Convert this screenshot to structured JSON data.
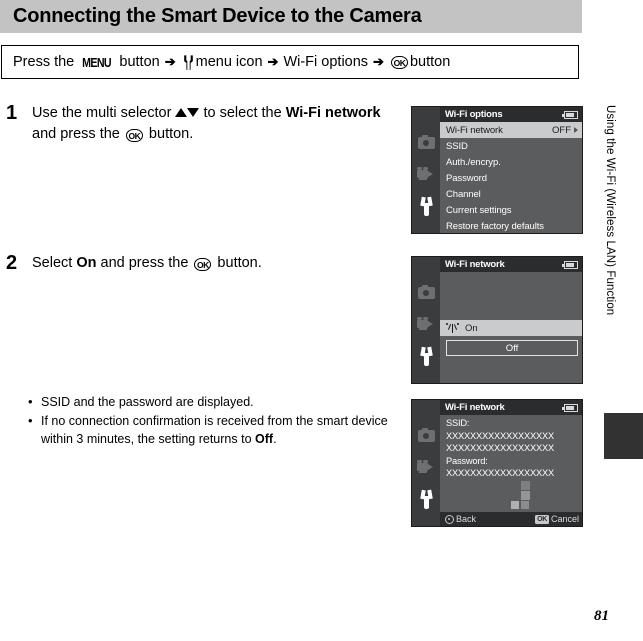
{
  "page": {
    "title": "Connecting the Smart Device to the Camera",
    "number": "81",
    "sidebar_label": "Using the Wi-Fi (Wireless LAN) Function"
  },
  "menu_path": {
    "prefix": "Press the",
    "menu_button": "MENU",
    "after_menu": "button",
    "arrow": "➔",
    "setup_icon": "wrench-icon",
    "setup_label": "menu icon",
    "option": "Wi-Fi options",
    "ok_label": "OK",
    "suffix": "button"
  },
  "steps": [
    {
      "number": "1",
      "text_part1": "Use the multi selector ",
      "up_arrow": "▲",
      "down_arrow": "▼",
      "text_part2": " to select the ",
      "bold1": "Wi-Fi network",
      "text_part3": " and press the ",
      "ok_label": "OK",
      "text_part4": " button."
    },
    {
      "number": "2",
      "text_part1": "Select ",
      "bold1": "On",
      "text_part2": " and press the ",
      "ok_label": "OK",
      "text_part3": " button."
    }
  ],
  "notes": [
    {
      "bullet": "•",
      "text": "SSID and the password are displayed."
    },
    {
      "bullet": "•",
      "text_part1": "If no connection confirmation is received from the smart device within 3 minutes, the setting returns to ",
      "bold": "Off",
      "text_part2": "."
    }
  ],
  "screens": [
    {
      "id": "wifi-options-menu",
      "header_title": "Wi-Fi options",
      "battery_icon": "battery-icon",
      "tabs": [
        "camera-icon",
        "movie-icon",
        "wrench-icon"
      ],
      "active_tab": "wrench-icon",
      "rows": [
        {
          "label": "Wi-Fi network",
          "value": "OFF",
          "selected": true,
          "has_caret": true
        },
        {
          "label": "SSID",
          "value": "",
          "selected": false,
          "has_caret": false
        },
        {
          "label": "Auth./encryp.",
          "value": "",
          "selected": false,
          "has_caret": false
        },
        {
          "label": "Password",
          "value": "",
          "selected": false,
          "has_caret": false
        },
        {
          "label": "Channel",
          "value": "",
          "selected": false,
          "has_caret": false
        },
        {
          "label": "Current settings",
          "value": "",
          "selected": false,
          "has_caret": false
        },
        {
          "label": "Restore factory defaults",
          "value": "",
          "selected": false,
          "has_caret": false
        }
      ]
    },
    {
      "id": "wifi-network-options",
      "header_title": "Wi-Fi network",
      "battery_icon": "battery-icon",
      "option_on": "On",
      "option_off": "Off",
      "on_icon": "wifi-antenna-icon",
      "highlighted": "On",
      "focused": "Off"
    },
    {
      "id": "wifi-network-credentials",
      "header_title": "Wi-Fi network",
      "battery_icon": "battery-icon",
      "ssid_label": "SSID:",
      "ssid_line1": "XXXXXXXXXXXXXXXXXX",
      "ssid_line2": "XXXXXXXXXXXXXXXXXX",
      "password_label": "Password:",
      "password_value": "XXXXXXXXXXXXXXXXXX",
      "footer_back": "Back",
      "footer_cancel": "Cancel",
      "footer_back_icon": "multi-selector-icon",
      "footer_cancel_icon": "ok-button-icon"
    }
  ],
  "colors": {
    "title_bar": "#c3c3c3",
    "screen_bg": "#5a5c5d",
    "screen_header": "#2b2c2d",
    "screen_tabbar": "#3b3c3d",
    "selection": "#c9cbcc",
    "side_tab": "#323232"
  }
}
